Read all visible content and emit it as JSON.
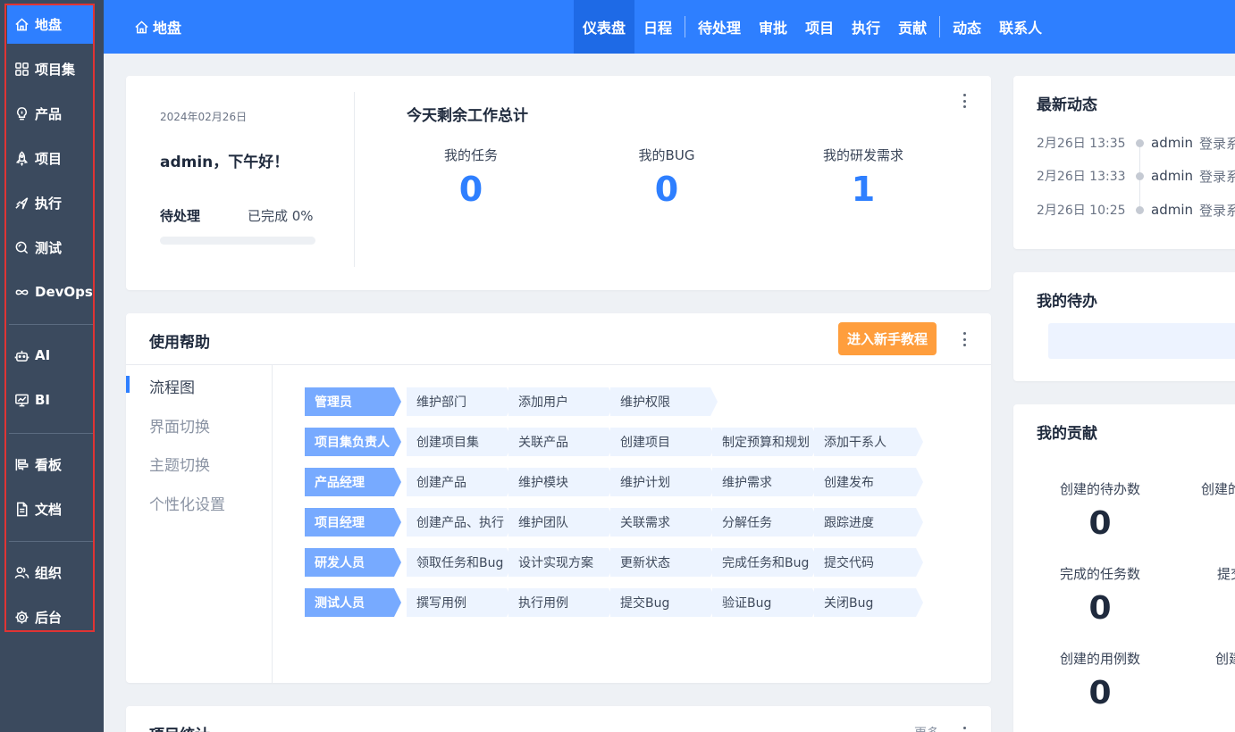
{
  "sidebar": {
    "items": [
      {
        "label": "地盘",
        "icon": "home-icon"
      },
      {
        "label": "项目集",
        "icon": "grid-icon"
      },
      {
        "label": "产品",
        "icon": "lightbulb-icon"
      },
      {
        "label": "项目",
        "icon": "rocket-icon"
      },
      {
        "label": "执行",
        "icon": "sprint-icon"
      },
      {
        "label": "测试",
        "icon": "magnifier-icon"
      },
      {
        "label": "DevOps",
        "icon": "infinity-icon"
      },
      {
        "label": "AI",
        "icon": "robot-icon"
      },
      {
        "label": "BI",
        "icon": "chart-board-icon"
      },
      {
        "label": "看板",
        "icon": "kanban-icon"
      },
      {
        "label": "文档",
        "icon": "document-icon"
      },
      {
        "label": "组织",
        "icon": "people-icon"
      },
      {
        "label": "后台",
        "icon": "gear-icon"
      }
    ],
    "active": "地盘"
  },
  "topbar": {
    "home_label": "地盘",
    "tabs": [
      "仪表盘",
      "日程",
      "待处理",
      "审批",
      "项目",
      "执行",
      "贡献",
      "动态",
      "联系人"
    ],
    "active_tab": "仪表盘"
  },
  "welcome": {
    "date": "2024年02月26日",
    "greeting": "admin，下午好！",
    "pending_label": "待处理",
    "done_label": "已完成 0%",
    "progress": 0,
    "summary_title": "今天剩余工作总计",
    "stats": [
      {
        "label": "我的任务",
        "value": "0"
      },
      {
        "label": "我的BUG",
        "value": "0"
      },
      {
        "label": "我的研发需求",
        "value": "1"
      }
    ]
  },
  "help": {
    "title": "使用帮助",
    "tutorial_button": "进入新手教程",
    "menu": [
      "流程图",
      "界面切换",
      "主题切换",
      "个性化设置"
    ],
    "active_menu": "流程图",
    "flow": [
      {
        "role": "管理员",
        "steps": [
          "维护部门",
          "添加用户",
          "维护权限"
        ]
      },
      {
        "role": "项目集负责人",
        "steps": [
          "创建项目集",
          "关联产品",
          "创建项目",
          "制定预算和规划",
          "添加干系人"
        ]
      },
      {
        "role": "产品经理",
        "steps": [
          "创建产品",
          "维护模块",
          "维护计划",
          "维护需求",
          "创建发布"
        ]
      },
      {
        "role": "项目经理",
        "steps": [
          "创建产品、执行",
          "维护团队",
          "关联需求",
          "分解任务",
          "跟踪进度"
        ]
      },
      {
        "role": "研发人员",
        "steps": [
          "领取任务和Bug",
          "设计实现方案",
          "更新状态",
          "完成任务和Bug",
          "提交代码"
        ]
      },
      {
        "role": "测试人员",
        "steps": [
          "撰写用例",
          "执行用例",
          "提交Bug",
          "验证Bug",
          "关闭Bug"
        ]
      }
    ]
  },
  "project_stats": {
    "title": "项目统计",
    "more_label": "更多"
  },
  "dynamics": {
    "title": "最新动态",
    "items": [
      {
        "time": "2月26日 13:35",
        "user": "admin",
        "action": "登录系统"
      },
      {
        "time": "2月26日 13:33",
        "user": "admin",
        "action": "登录系统"
      },
      {
        "time": "2月26日 10:25",
        "user": "admin",
        "action": "登录系统"
      }
    ]
  },
  "todo": {
    "title": "我的待办",
    "add_symbol": "+"
  },
  "contribution": {
    "title": "我的贡献",
    "items": [
      {
        "label": "创建的待办数",
        "value": "0"
      },
      {
        "label": "创建的",
        "value": ""
      },
      {
        "label": "完成的任务数",
        "value": "0"
      },
      {
        "label": "提交",
        "value": ""
      },
      {
        "label": "创建的用例数",
        "value": "0"
      },
      {
        "label": "创建",
        "value": ""
      }
    ]
  },
  "colors": {
    "primary": "#2e7fff",
    "sidebar_bg": "#3b4a5e",
    "accent_button": "#ff9e3d",
    "highlight_frame": "#e03434"
  }
}
